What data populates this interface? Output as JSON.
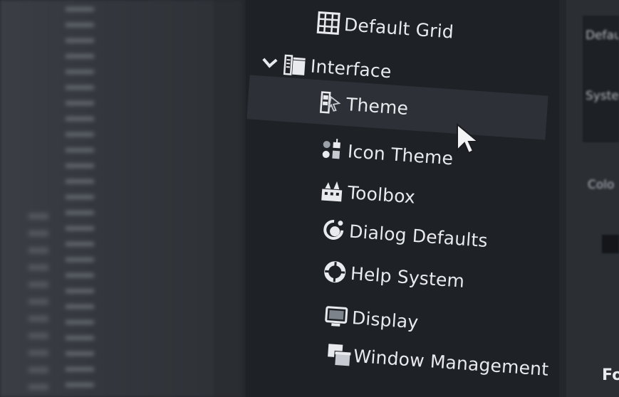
{
  "tree": {
    "items": [
      {
        "label": "Default Grid",
        "icon": "grid-icon"
      },
      {
        "label": "Interface",
        "icon": "interface-icon",
        "expanded": true
      },
      {
        "label": "Theme",
        "icon": "theme-icon",
        "selected": true
      },
      {
        "label": "Icon Theme",
        "icon": "icon-theme-icon"
      },
      {
        "label": "Toolbox",
        "icon": "toolbox-icon"
      },
      {
        "label": "Dialog Defaults",
        "icon": "dialog-defaults-icon"
      },
      {
        "label": "Help System",
        "icon": "help-system-icon"
      },
      {
        "label": "Display",
        "icon": "display-icon"
      },
      {
        "label": "Window Management",
        "icon": "window-management-icon"
      }
    ]
  },
  "right_panel": {
    "partial_labels": [
      "Defau",
      "Syste",
      "Colo",
      "Fo"
    ]
  },
  "colors": {
    "panel_bg": "#1e2125",
    "selected_bg": "#2d3137",
    "text": "#e8eaed"
  }
}
